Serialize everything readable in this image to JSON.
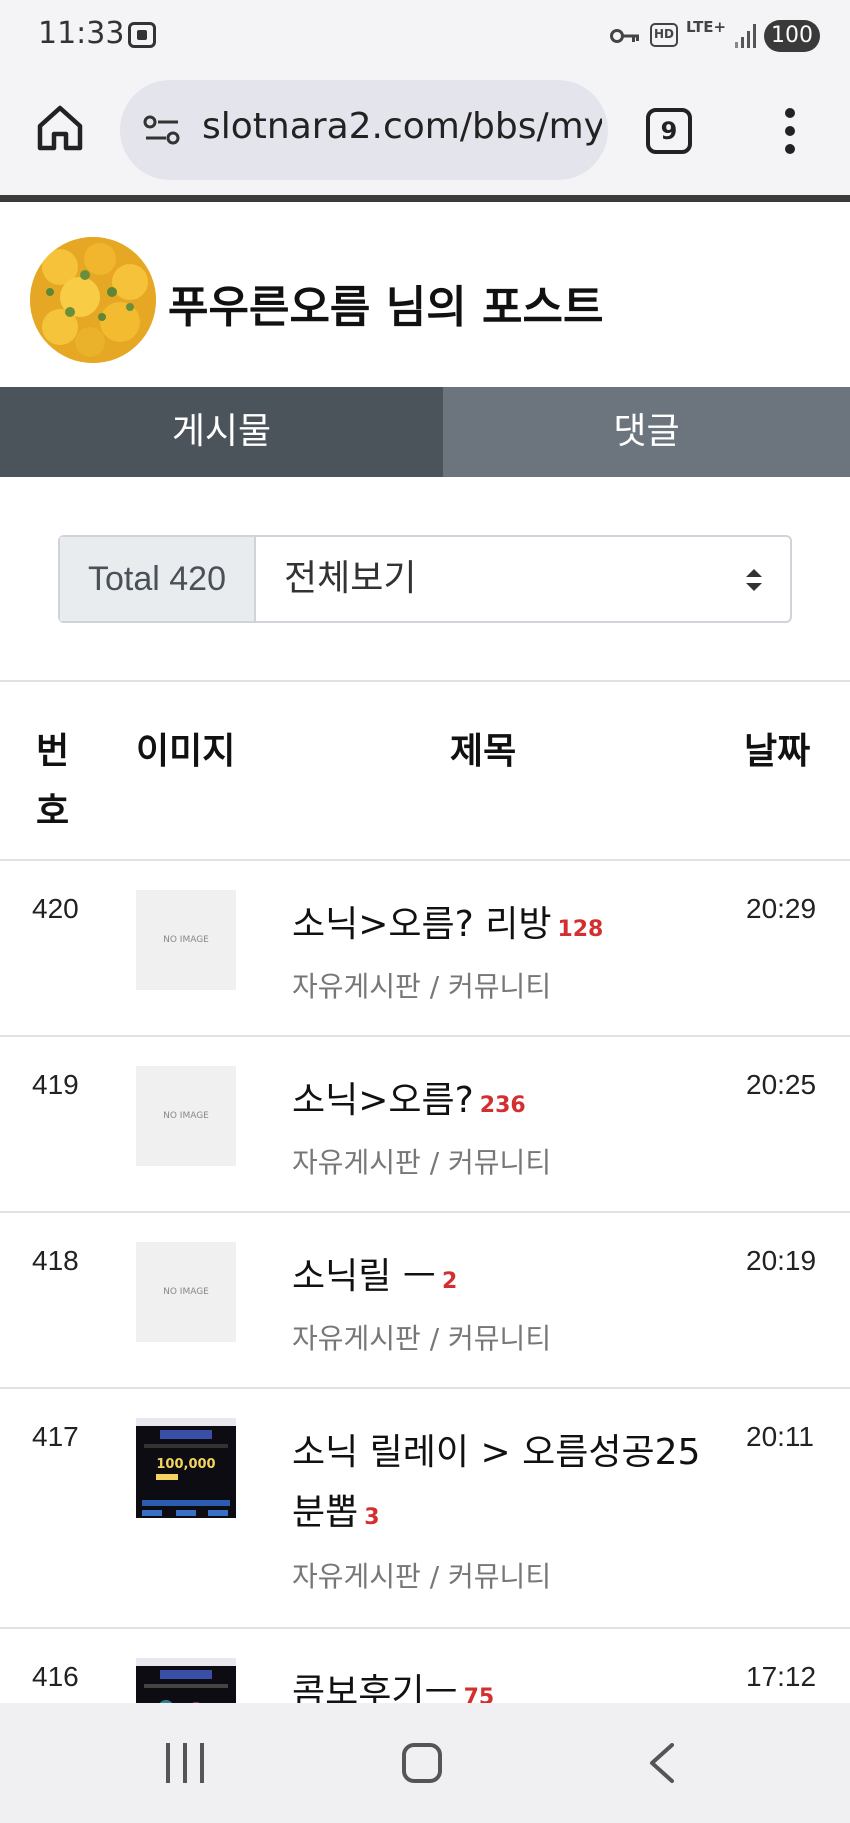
{
  "status_bar": {
    "time": "11:33",
    "network": "LTE+",
    "hd_label": "HD",
    "battery": "100",
    "icons": [
      "screen-record-icon",
      "key-icon",
      "hd-voice-icon",
      "signal-icon",
      "battery-icon"
    ]
  },
  "browser": {
    "url": "slotnara2.com/bbs/my",
    "tab_count": "9",
    "icons": [
      "home-icon",
      "site-settings-icon",
      "tabs-icon",
      "more-vert-icon"
    ]
  },
  "profile": {
    "title": "푸우른오름 님의 포스트"
  },
  "tabs": [
    {
      "label": "게시물",
      "active": true
    },
    {
      "label": "댓글",
      "active": false
    }
  ],
  "filter": {
    "total": "Total 420",
    "selected": "전체보기"
  },
  "table": {
    "headers": {
      "num": "번호",
      "image": "이미지",
      "title": "제목",
      "date": "날짜"
    },
    "rows": [
      {
        "num": "420",
        "image": "NO IMAGE",
        "title": "소닉>오름? 리방",
        "count": "128",
        "category": "자유게시판 / 커뮤니티",
        "date": "20:29"
      },
      {
        "num": "419",
        "image": "NO IMAGE",
        "title": "소닉>오름?",
        "count": "236",
        "category": "자유게시판 / 커뮤니티",
        "date": "20:25"
      },
      {
        "num": "418",
        "image": "NO IMAGE",
        "title": "소닉릴 ㅡ",
        "count": "2",
        "category": "자유게시판 / 커뮤니티",
        "date": "20:19"
      },
      {
        "num": "417",
        "image": "100,000",
        "title": "소닉 릴레이 > 오름성공25분뽑",
        "count": "3",
        "category": "자유게시판 / 커뮤니티",
        "date": "20:11"
      },
      {
        "num": "416",
        "image": "",
        "title": "콤보후기ㅡ",
        "count": "75",
        "category": "",
        "date": "17:12"
      }
    ]
  },
  "nav_bar": {
    "icons": [
      "recent-apps-icon",
      "home-icon",
      "back-icon"
    ]
  },
  "colors": {
    "tab_active": "#4b535b",
    "tab_inactive": "#6c757d",
    "count_red": "#d32f2f",
    "browser_bg": "#f4f4f7"
  }
}
